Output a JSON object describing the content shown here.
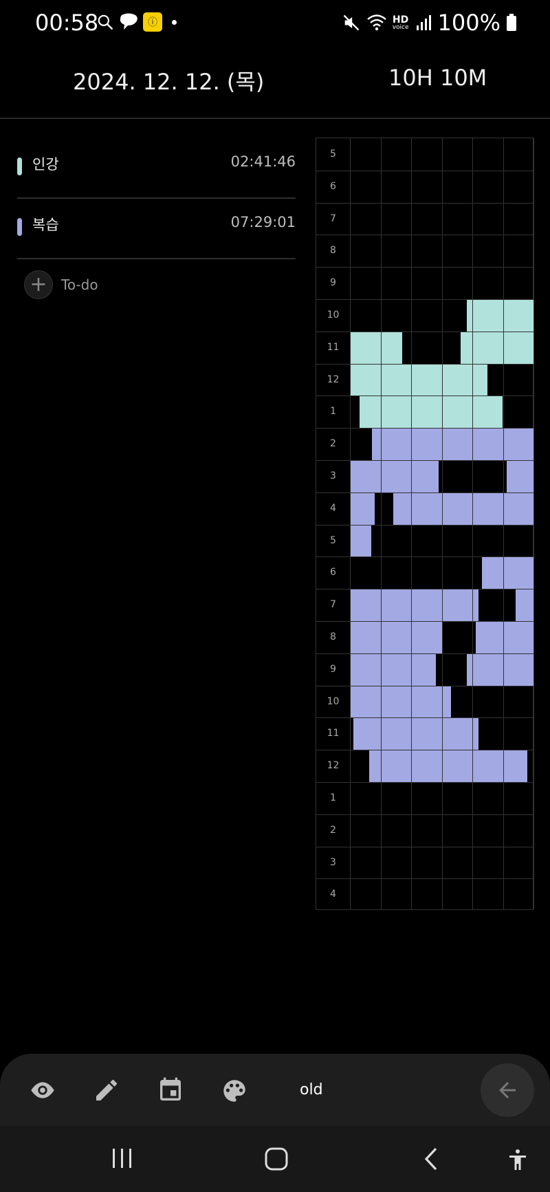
{
  "status_bar": {
    "time": "00:58",
    "battery": "100%",
    "hd_label": "HD",
    "voice_label": "voice",
    "kakao_label": "ⓘ"
  },
  "header": {
    "date": "2024. 12. 12. (목)",
    "total": "10H 10M"
  },
  "tasks": [
    {
      "name": "인강",
      "duration": "02:41:46",
      "color": "#b1e2dc"
    },
    {
      "name": "복습",
      "duration": "07:29:01",
      "color": "#a3a9e3"
    }
  ],
  "todo_label": "To-do",
  "grid": {
    "hours": [
      "5",
      "6",
      "7",
      "8",
      "9",
      "10",
      "11",
      "12",
      "1",
      "2",
      "3",
      "4",
      "5",
      "6",
      "7",
      "8",
      "9",
      "10",
      "11",
      "12",
      "1",
      "2",
      "3",
      "4"
    ],
    "colors": {
      "teal": "#b1e2dc",
      "purple": "#a3a9e3"
    }
  },
  "toolbar": {
    "text": "old",
    "icons": [
      "eye-icon",
      "pencil-icon",
      "calendar-icon",
      "palette-icon",
      "arrow-left-icon"
    ]
  },
  "navbar": {
    "icons": [
      "recent-apps-icon",
      "home-icon",
      "back-icon",
      "accessibility-icon"
    ]
  }
}
